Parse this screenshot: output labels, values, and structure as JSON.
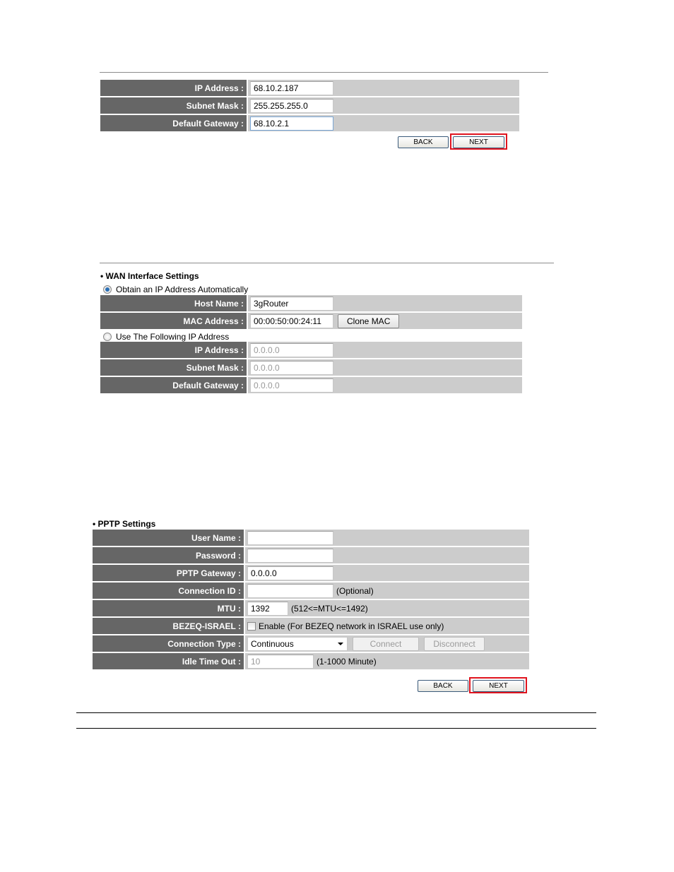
{
  "section1": {
    "rows": [
      {
        "label": "IP Address :",
        "value": "68.10.2.187"
      },
      {
        "label": "Subnet Mask :",
        "value": "255.255.255.0"
      },
      {
        "label": "Default Gateway :",
        "value": "68.10.2.1"
      }
    ],
    "back_label": "BACK",
    "next_label": "NEXT"
  },
  "section2": {
    "title": "WAN Interface Settings",
    "auto_option": "Obtain an IP Address Automatically",
    "auto_selected": true,
    "auto_rows": [
      {
        "label": "Host Name :",
        "value": "3gRouter"
      },
      {
        "label": "MAC Address :",
        "value": "00:00:50:00:24:11"
      }
    ],
    "clone_mac_label": "Clone MAC",
    "static_option": "Use The Following IP Address",
    "static_rows": [
      {
        "label": "IP Address :",
        "value": "0.0.0.0"
      },
      {
        "label": "Subnet Mask :",
        "value": "0.0.0.0"
      },
      {
        "label": "Default Gateway :",
        "value": "0.0.0.0"
      }
    ]
  },
  "section3": {
    "title": "PPTP Settings",
    "rows": {
      "user_name": {
        "label": "User Name :",
        "value": ""
      },
      "password": {
        "label": "Password :",
        "value": ""
      },
      "pptp_gateway": {
        "label": "PPTP Gateway :",
        "value": "0.0.0.0"
      },
      "connection_id": {
        "label": "Connection ID :",
        "value": "",
        "note": "(Optional)"
      },
      "mtu": {
        "label": "MTU :",
        "value": "1392",
        "note": "(512<=MTU<=1492)"
      },
      "bezeq": {
        "label": "BEZEQ-ISRAEL :",
        "checkbox_label": "Enable (For BEZEQ network in ISRAEL use only)",
        "checked": false
      },
      "connection_type": {
        "label": "Connection Type :",
        "selected": "Continuous",
        "connect_label": "Connect",
        "disconnect_label": "Disconnect"
      },
      "idle_time_out": {
        "label": "Idle Time Out :",
        "value": "10",
        "note": "(1-1000 Minute)"
      }
    },
    "back_label": "BACK",
    "next_label": "NEXT"
  }
}
